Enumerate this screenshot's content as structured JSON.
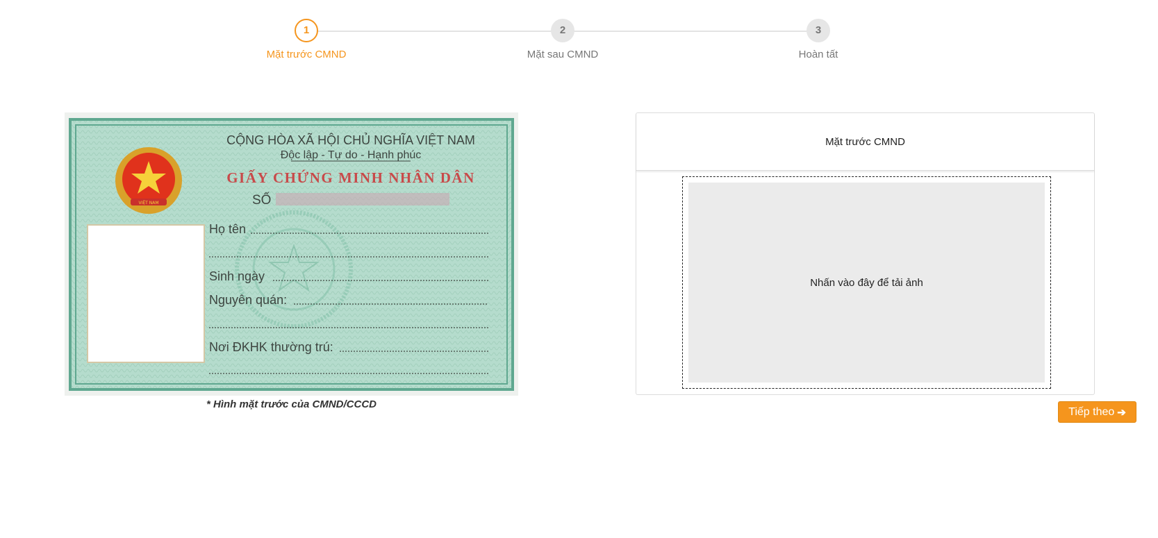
{
  "stepper": {
    "steps": [
      {
        "number": "1",
        "label": "Mặt trước CMND",
        "active": true
      },
      {
        "number": "2",
        "label": "Mặt sau CMND",
        "active": false
      },
      {
        "number": "3",
        "label": "Hoàn tất",
        "active": false
      }
    ]
  },
  "sample_card": {
    "header_line1": "CỘNG HÒA XÃ HỘI CHỦ NGHĨA VIỆT NAM",
    "header_line2": "Độc lập - Tự do - Hạnh phúc",
    "card_title": "GIẤY CHỨNG MINH NHÂN DÂN",
    "number_label": "SỐ",
    "field_name": "Họ tên",
    "field_dob": "Sinh ngày",
    "field_origin": "Nguyên quán:",
    "field_residence": "Nơi ĐKHK thường trú:",
    "emblem_text": "VIỆT NAM",
    "caption": "* Hình mặt trước của CMND/CCCD"
  },
  "upload_panel": {
    "title": "Mặt trước CMND",
    "dropzone_text": "Nhấn vào đây để tải ảnh"
  },
  "next_button": {
    "label": "Tiếp theo",
    "icon": "arrow-right-icon"
  },
  "colors": {
    "accent": "#f5951d",
    "card_bg": "#b5dccd",
    "card_border": "#5fa890",
    "card_title": "#c84a4a"
  }
}
